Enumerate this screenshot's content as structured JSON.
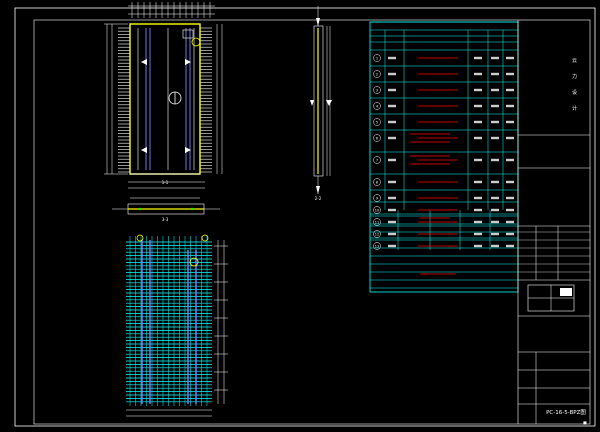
{
  "drawing": {
    "section_label_1": "1-1",
    "section_label_2": "2-2",
    "section_label_3": "3-3"
  },
  "schedule": {
    "rows": [
      "1",
      "2",
      "3",
      "4",
      "5",
      "6",
      "7",
      "8",
      "9",
      "10",
      "11",
      "12",
      "13"
    ]
  },
  "title_block": {
    "code": "PC-16-5-BPZ图"
  },
  "colors": {
    "frame": "#ffffff",
    "table_line": "#00ffff",
    "rebar": "#ffff00",
    "dimension": "#00ff00",
    "red_line": "#ff0000",
    "mesh": "#00ffff",
    "accent": "#8080ff"
  }
}
